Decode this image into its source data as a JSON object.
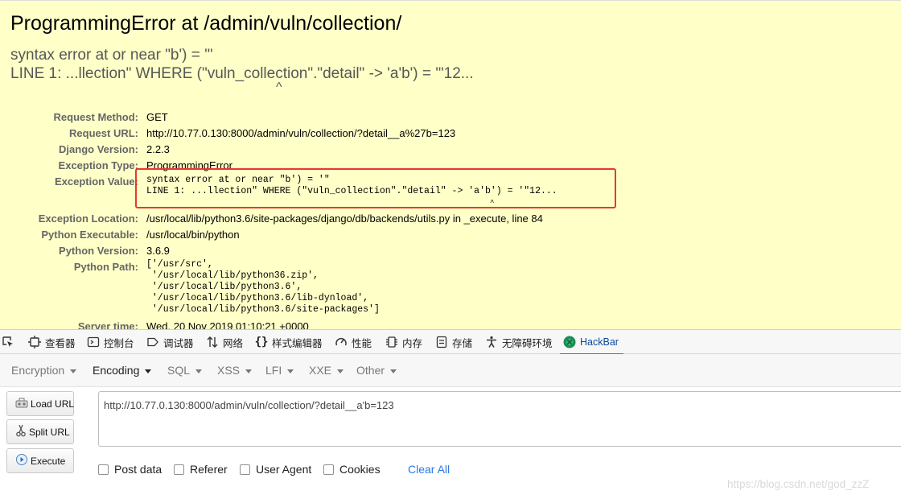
{
  "error_page": {
    "title": "ProgrammingError at /admin/vuln/collection/",
    "summary_line1": "syntax error at or near \"b') = '\"",
    "summary_line2": "LINE 1: ...llection\" WHERE (\"vuln_collection\".\"detail\" -> 'a'b') = '\"12...",
    "summary_caret": "^",
    "rows": {
      "request_method": {
        "label": "Request Method:",
        "value": "GET"
      },
      "request_url": {
        "label": "Request URL:",
        "value": "http://10.77.0.130:8000/admin/vuln/collection/?detail__a%27b=123"
      },
      "django_version": {
        "label": "Django Version:",
        "value": "2.2.3"
      },
      "exception_type": {
        "label": "Exception Type:",
        "value": "ProgrammingError"
      },
      "exception_value": {
        "label": "Exception Value:",
        "line1": "syntax error at or near \"b') = '\"",
        "line2": "LINE 1: ...llection\" WHERE (\"vuln_collection\".\"detail\" -> 'a'b') = '\"12...",
        "caret": "^"
      },
      "exception_location": {
        "label": "Exception Location:",
        "value": "/usr/local/lib/python3.6/site-packages/django/db/backends/utils.py in _execute, line 84"
      },
      "python_executable": {
        "label": "Python Executable:",
        "value": "/usr/local/bin/python"
      },
      "python_version": {
        "label": "Python Version:",
        "value": "3.6.9"
      },
      "python_path": {
        "label": "Python Path:",
        "lines": [
          "['/usr/src',",
          " '/usr/local/lib/python36.zip',",
          " '/usr/local/lib/python3.6',",
          " '/usr/local/lib/python3.6/lib-dynload',",
          " '/usr/local/lib/python3.6/site-packages']"
        ]
      },
      "server_time": {
        "label": "Server time:",
        "value": "Wed, 20 Nov 2019 01:10:21 +0000"
      }
    },
    "highlight_color": "#e53a2e",
    "background_color": "#ffffc8"
  },
  "devtools": {
    "tabs": [
      {
        "label": "查看器",
        "icon": "inspector-icon"
      },
      {
        "label": "控制台",
        "icon": "console-icon"
      },
      {
        "label": "调试器",
        "icon": "debugger-icon"
      },
      {
        "label": "网络",
        "icon": "network-icon"
      },
      {
        "label": "样式编辑器",
        "icon": "style-editor-icon"
      },
      {
        "label": "性能",
        "icon": "performance-icon"
      },
      {
        "label": "内存",
        "icon": "memory-icon"
      },
      {
        "label": "存储",
        "icon": "storage-icon"
      },
      {
        "label": "无障碍环境",
        "icon": "accessibility-icon"
      },
      {
        "label": "HackBar",
        "icon": "hackbar-icon"
      }
    ],
    "active_tab": "HackBar"
  },
  "hackbar": {
    "menu": [
      "Encryption",
      "Encoding",
      "SQL",
      "XSS",
      "LFI",
      "XXE",
      "Other"
    ],
    "buttons": {
      "load_url": "Load URL",
      "split_url": "Split URL",
      "execute": "Execute"
    },
    "url_value": "http://10.77.0.130:8000/admin/vuln/collection/?detail__a'b=123",
    "options": [
      "Post data",
      "Referer",
      "User Agent",
      "Cookies"
    ],
    "clear_all": "Clear All"
  },
  "watermark": "https://blog.csdn.net/god_zzZ"
}
